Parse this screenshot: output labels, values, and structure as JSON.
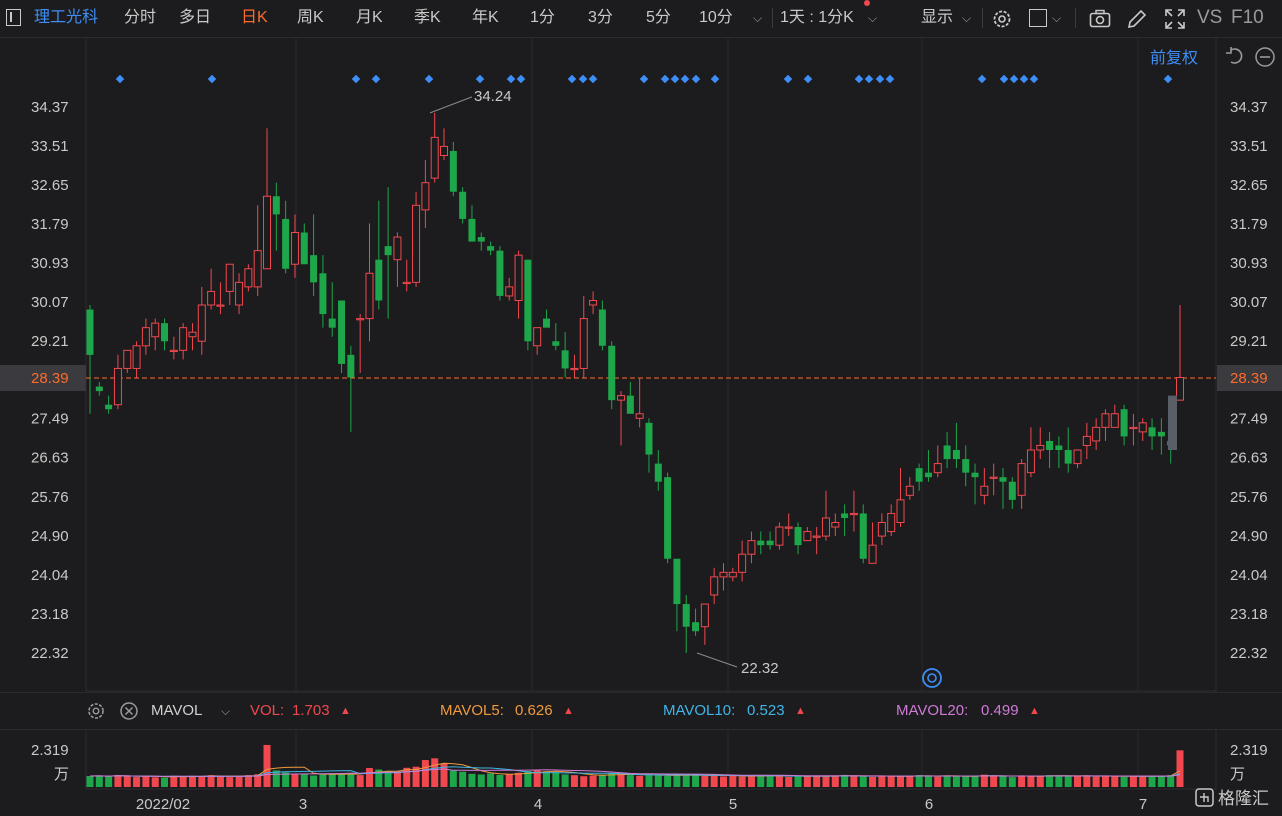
{
  "toolbar": {
    "stock_name": "理工光科",
    "tabs": [
      "分时",
      "多日",
      "日K",
      "周K",
      "月K",
      "季K",
      "年K",
      "1分",
      "3分",
      "5分",
      "10分"
    ],
    "active_tab": "日K",
    "period_select": "1天 : 1分K",
    "display_label": "显示",
    "vs_label": "VS",
    "f10_label": "F10"
  },
  "adjust_label": "前复权",
  "price_axis": [
    "34.37",
    "33.51",
    "32.65",
    "31.79",
    "30.93",
    "30.07",
    "29.21",
    "28.39",
    "27.49",
    "26.63",
    "25.76",
    "24.90",
    "24.04",
    "23.18",
    "22.32"
  ],
  "current_price": "28.39",
  "high_label": "34.24",
  "low_label": "22.32",
  "time_axis": [
    "2022/02",
    "3",
    "4",
    "5",
    "6",
    "7"
  ],
  "volume_panel": {
    "indicator": "MAVOL",
    "vol_label": "VOL:",
    "vol_value": "1.703",
    "mavol5_label": "MAVOL5:",
    "mavol5_value": "0.626",
    "mavol10_label": "MAVOL10:",
    "mavol10_value": "0.523",
    "mavol20_label": "MAVOL20:",
    "mavol20_value": "0.499",
    "axis_value": "2.319",
    "axis_unit": "万"
  },
  "watermark": "格隆汇",
  "colors": {
    "up": "#f0484e",
    "down": "#1ea64a",
    "accent": "#ff6b2c",
    "blue": "#3e8ef7",
    "mavol5": "#f09a3e",
    "mavol10": "#3fb5e8",
    "mavol20": "#d07ad6"
  },
  "chart_data": {
    "type": "candlestick",
    "unit": "CNY",
    "candles": [
      [
        29.9,
        28.9,
        30.0,
        27.6
      ],
      [
        28.2,
        28.1,
        28.3,
        28.0
      ],
      [
        27.8,
        27.7,
        28.0,
        27.6
      ],
      [
        27.8,
        28.6,
        28.9,
        27.7
      ],
      [
        28.6,
        29.0,
        29.0,
        28.5
      ],
      [
        28.6,
        29.1,
        29.2,
        28.4
      ],
      [
        29.1,
        29.5,
        29.7,
        28.9
      ],
      [
        29.3,
        29.6,
        29.7,
        29.0
      ],
      [
        29.6,
        29.2,
        29.7,
        29.0
      ],
      [
        29.0,
        29.0,
        29.3,
        28.8
      ],
      [
        29.0,
        29.5,
        29.6,
        28.8
      ],
      [
        29.3,
        29.4,
        29.6,
        29.0
      ],
      [
        29.2,
        30.0,
        30.4,
        28.9
      ],
      [
        30.0,
        30.3,
        30.8,
        29.9
      ],
      [
        30.0,
        30.0,
        30.5,
        29.8
      ],
      [
        30.3,
        30.9,
        30.9,
        30.0
      ],
      [
        30.0,
        30.5,
        30.7,
        29.8
      ],
      [
        30.4,
        30.8,
        30.9,
        30.3
      ],
      [
        30.4,
        31.2,
        32.2,
        30.2
      ],
      [
        30.8,
        32.4,
        33.9,
        30.8
      ],
      [
        32.4,
        32.0,
        32.7,
        31.2
      ],
      [
        31.9,
        30.8,
        32.3,
        30.7
      ],
      [
        30.9,
        31.6,
        32.0,
        30.6
      ],
      [
        31.6,
        30.9,
        31.8,
        30.9
      ],
      [
        31.1,
        30.5,
        32.0,
        30.2
      ],
      [
        30.7,
        29.8,
        31.1,
        29.5
      ],
      [
        29.7,
        29.5,
        30.5,
        29.3
      ],
      [
        30.1,
        28.7,
        30.1,
        28.5
      ],
      [
        28.9,
        28.4,
        29.1,
        27.2
      ],
      [
        29.7,
        29.7,
        29.8,
        28.5
      ],
      [
        29.7,
        30.7,
        31.8,
        29.2
      ],
      [
        31.0,
        30.1,
        32.3,
        29.9
      ],
      [
        31.3,
        31.1,
        32.6,
        29.7
      ],
      [
        31.0,
        31.5,
        31.6,
        30.4
      ],
      [
        30.5,
        30.5,
        31.0,
        30.3
      ],
      [
        30.5,
        32.2,
        32.5,
        30.4
      ],
      [
        32.1,
        32.7,
        33.2,
        31.7
      ],
      [
        32.8,
        33.7,
        34.24,
        32.7
      ],
      [
        33.3,
        33.5,
        33.9,
        33.2
      ],
      [
        33.4,
        32.5,
        33.6,
        32.4
      ],
      [
        32.5,
        31.9,
        32.6,
        31.8
      ],
      [
        31.9,
        31.4,
        32.2,
        31.4
      ],
      [
        31.5,
        31.4,
        31.6,
        31.2
      ],
      [
        31.3,
        31.2,
        31.4,
        31.1
      ],
      [
        31.2,
        30.2,
        31.3,
        30.1
      ],
      [
        30.2,
        30.4,
        30.6,
        30.1
      ],
      [
        30.1,
        31.1,
        31.2,
        29.7
      ],
      [
        31.0,
        29.2,
        31.0,
        29.0
      ],
      [
        29.1,
        29.5,
        29.5,
        28.9
      ],
      [
        29.7,
        29.5,
        29.9,
        29.6
      ],
      [
        29.2,
        29.1,
        29.6,
        29.0
      ],
      [
        29.0,
        28.6,
        29.4,
        28.4
      ],
      [
        28.6,
        28.6,
        28.9,
        28.4
      ],
      [
        28.6,
        29.7,
        30.2,
        28.4
      ],
      [
        30.0,
        30.1,
        30.3,
        29.8
      ],
      [
        29.9,
        29.1,
        30.1,
        29.0
      ],
      [
        29.1,
        27.9,
        29.2,
        27.7
      ],
      [
        27.9,
        28.0,
        28.1,
        26.9
      ],
      [
        28.0,
        27.6,
        28.3,
        27.6
      ],
      [
        27.5,
        27.6,
        28.4,
        27.3
      ],
      [
        27.4,
        26.7,
        27.5,
        26.3
      ],
      [
        26.5,
        26.1,
        26.8,
        25.9
      ],
      [
        26.2,
        24.4,
        26.3,
        24.3
      ],
      [
        24.4,
        23.4,
        24.4,
        22.8
      ],
      [
        23.4,
        22.9,
        23.6,
        22.32
      ],
      [
        23.0,
        22.8,
        23.3,
        22.7
      ],
      [
        22.9,
        23.4,
        23.4,
        22.5
      ],
      [
        23.6,
        24.0,
        24.2,
        23.4
      ],
      [
        24.0,
        24.1,
        24.3,
        23.7
      ],
      [
        24.0,
        24.1,
        24.2,
        23.9
      ],
      [
        24.1,
        24.5,
        24.8,
        23.9
      ],
      [
        24.5,
        24.8,
        25.0,
        24.3
      ],
      [
        24.8,
        24.7,
        25.0,
        24.5
      ],
      [
        24.8,
        24.7,
        25.0,
        24.6
      ],
      [
        24.7,
        25.1,
        25.2,
        24.6
      ],
      [
        25.1,
        25.1,
        25.4,
        24.9
      ],
      [
        25.1,
        24.7,
        25.2,
        24.5
      ],
      [
        24.8,
        25.0,
        25.1,
        24.8
      ],
      [
        24.9,
        24.9,
        25.1,
        24.5
      ],
      [
        24.9,
        25.3,
        25.9,
        24.8
      ],
      [
        25.1,
        25.2,
        25.4,
        24.9
      ],
      [
        25.4,
        25.3,
        25.6,
        24.9
      ],
      [
        25.4,
        25.4,
        25.9,
        25.0
      ],
      [
        25.4,
        24.4,
        25.6,
        24.3
      ],
      [
        24.3,
        24.7,
        25.2,
        24.3
      ],
      [
        24.9,
        25.2,
        25.4,
        24.7
      ],
      [
        25.0,
        25.4,
        25.6,
        24.9
      ],
      [
        25.2,
        25.7,
        26.4,
        25.1
      ],
      [
        25.8,
        26.0,
        26.2,
        25.7
      ],
      [
        26.4,
        26.1,
        26.5,
        25.9
      ],
      [
        26.3,
        26.2,
        26.8,
        26.1
      ],
      [
        26.3,
        26.5,
        26.9,
        26.2
      ],
      [
        26.9,
        26.6,
        27.2,
        26.4
      ],
      [
        26.8,
        26.6,
        27.4,
        26.4
      ],
      [
        26.6,
        26.3,
        26.9,
        26.0
      ],
      [
        26.3,
        26.2,
        26.5,
        25.6
      ],
      [
        25.8,
        26.0,
        26.4,
        25.6
      ],
      [
        26.2,
        26.2,
        26.5,
        25.8
      ],
      [
        26.2,
        26.1,
        26.4,
        25.5
      ],
      [
        26.1,
        25.7,
        26.2,
        25.5
      ],
      [
        25.8,
        26.5,
        26.6,
        25.5
      ],
      [
        26.3,
        26.8,
        27.3,
        26.2
      ],
      [
        26.8,
        26.9,
        27.3,
        26.6
      ],
      [
        27.0,
        26.8,
        27.2,
        26.4
      ],
      [
        26.9,
        26.8,
        27.1,
        26.4
      ],
      [
        26.8,
        26.5,
        27.3,
        26.3
      ],
      [
        26.5,
        26.8,
        26.8,
        26.4
      ],
      [
        26.9,
        27.1,
        27.4,
        26.6
      ],
      [
        27.0,
        27.3,
        27.5,
        26.8
      ],
      [
        27.3,
        27.6,
        27.7,
        27.0
      ],
      [
        27.3,
        27.6,
        27.8,
        27.3
      ],
      [
        27.7,
        27.1,
        27.8,
        26.9
      ],
      [
        27.3,
        27.3,
        27.6,
        26.9
      ],
      [
        27.2,
        27.4,
        27.5,
        27.0
      ],
      [
        27.3,
        27.1,
        27.5,
        26.8
      ],
      [
        27.2,
        27.1,
        27.5,
        26.7
      ],
      [
        27.0,
        26.9,
        27.2,
        26.5
      ],
      [
        27.9,
        28.4,
        30.0,
        27.9
      ]
    ],
    "volumes": [
      0.51,
      0.52,
      0.49,
      0.55,
      0.5,
      0.46,
      0.52,
      0.45,
      0.43,
      0.52,
      0.49,
      0.52,
      0.49,
      0.55,
      0.5,
      0.46,
      0.52,
      0.55,
      0.59,
      1.95,
      0.77,
      0.68,
      0.58,
      0.62,
      0.53,
      0.59,
      0.63,
      0.58,
      0.66,
      0.55,
      0.88,
      0.81,
      0.75,
      0.66,
      0.89,
      0.94,
      1.25,
      1.33,
      1.09,
      0.76,
      0.71,
      0.61,
      0.58,
      0.63,
      0.56,
      0.58,
      0.66,
      0.74,
      0.81,
      0.73,
      0.69,
      0.58,
      0.55,
      0.5,
      0.53,
      0.58,
      0.65,
      0.61,
      0.55,
      0.52,
      0.54,
      0.57,
      0.51,
      0.56,
      0.53,
      0.59,
      0.51,
      0.55,
      0.49,
      0.52,
      0.48,
      0.51,
      0.56,
      0.5,
      0.52,
      0.47,
      0.51,
      0.5,
      0.52,
      0.48,
      0.51,
      0.56,
      0.52,
      0.5,
      0.47,
      0.53,
      0.5,
      0.49,
      0.51,
      0.55,
      0.52,
      0.48,
      0.53,
      0.5,
      0.49,
      0.51,
      0.57,
      0.52,
      0.49,
      0.46,
      0.53,
      0.52,
      0.51,
      0.55,
      0.49,
      0.52,
      0.5,
      0.53,
      0.48,
      0.51,
      0.5,
      0.47,
      0.52,
      0.49,
      0.51,
      0.5,
      0.55,
      1.7
    ],
    "ylim": [
      22.32,
      34.37
    ]
  }
}
